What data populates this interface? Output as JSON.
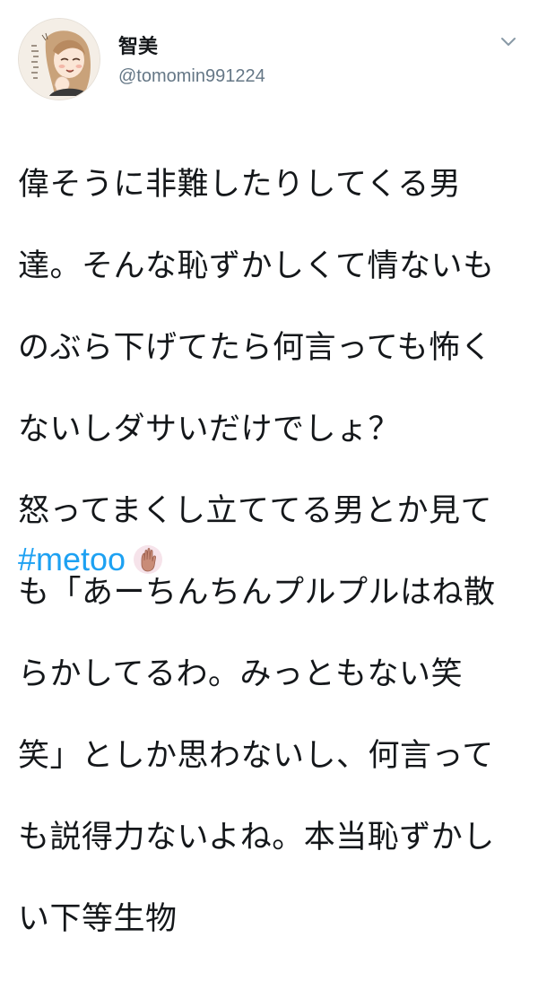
{
  "tweet": {
    "author": {
      "display_name": "智美",
      "handle": "@tomomin991224"
    },
    "body_lines": [
      "偉そうに非難したりしてくる男",
      "達。そんな恥ずかしくて情ないも",
      "のぶら下げてたら何言っても怖く",
      "ないしダサいだけでしょ？",
      "怒ってまくし立ててる男とか見て",
      "も「あーちんちんプルプルはね散",
      "らかしてるわ。みっともない笑",
      "笑」としか思わないし、何言って",
      "も説得力ないよね。本当恥ずかし",
      "い下等生物"
    ],
    "hashtag": "#metoo",
    "emoji": "raised-hand-emoji",
    "menu_icon": "chevron-down-icon"
  },
  "colors": {
    "text": "#14171a",
    "secondary": "#657786",
    "link": "#1da1f2"
  }
}
